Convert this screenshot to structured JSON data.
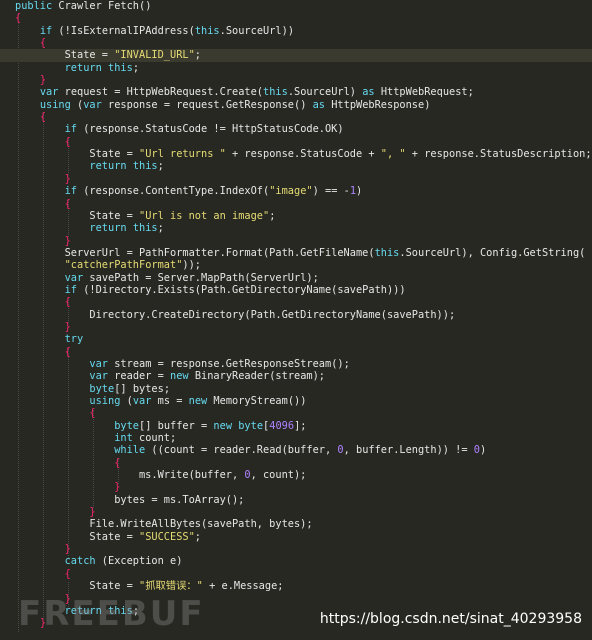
{
  "editor": {
    "lines": [
      "public Crawler Fetch()",
      "{",
      "    if (!IsExternalIPAddress(this.SourceUrl))",
      "    {",
      "        State = \"INVALID_URL\";",
      "        return this;",
      "    }",
      "    var request = HttpWebRequest.Create(this.SourceUrl) as HttpWebRequest;",
      "    using (var response = request.GetResponse() as HttpWebResponse)",
      "    {",
      "        if (response.StatusCode != HttpStatusCode.OK)",
      "        {",
      "            State = \"Url returns \" + response.StatusCode + \", \" + response.StatusDescription;",
      "            return this;",
      "        }",
      "        if (response.ContentType.IndexOf(\"image\") == -1)",
      "        {",
      "            State = \"Url is not an image\";",
      "            return this;",
      "        }",
      "        ServerUrl = PathFormatter.Format(Path.GetFileName(this.SourceUrl), Config.GetString(",
      "        \"catcherPathFormat\"));",
      "        var savePath = Server.MapPath(ServerUrl);",
      "        if (!Directory.Exists(Path.GetDirectoryName(savePath)))",
      "        {",
      "            Directory.CreateDirectory(Path.GetDirectoryName(savePath));",
      "        }",
      "        try",
      "        {",
      "            var stream = response.GetResponseStream();",
      "            var reader = new BinaryReader(stream);",
      "            byte[] bytes;",
      "            using (var ms = new MemoryStream())",
      "            {",
      "                byte[] buffer = new byte[4096];",
      "                int count;",
      "                while ((count = reader.Read(buffer, 0, buffer.Length)) != 0)",
      "                {",
      "                    ms.Write(buffer, 0, count);",
      "                }",
      "                bytes = ms.ToArray();",
      "            }",
      "            File.WriteAllBytes(savePath, bytes);",
      "            State = \"SUCCESS\";",
      "        }",
      "        catch (Exception e)",
      "        {",
      "            State = \"抓取错误：\" + e.Message;",
      "        }",
      "        return this;",
      "    }"
    ],
    "highlighted_line": 4
  },
  "watermark": {
    "brand": "FREEBUF",
    "url": "https://blog.csdn.net/sinat_40293958"
  },
  "colors": {
    "background": "#272822",
    "text": "#e6e6e6",
    "keyword": "#66d9ef",
    "string": "#e6db74",
    "number": "#ae81ff",
    "brace": "#f92672",
    "line_highlight": "#3a3a2e"
  }
}
